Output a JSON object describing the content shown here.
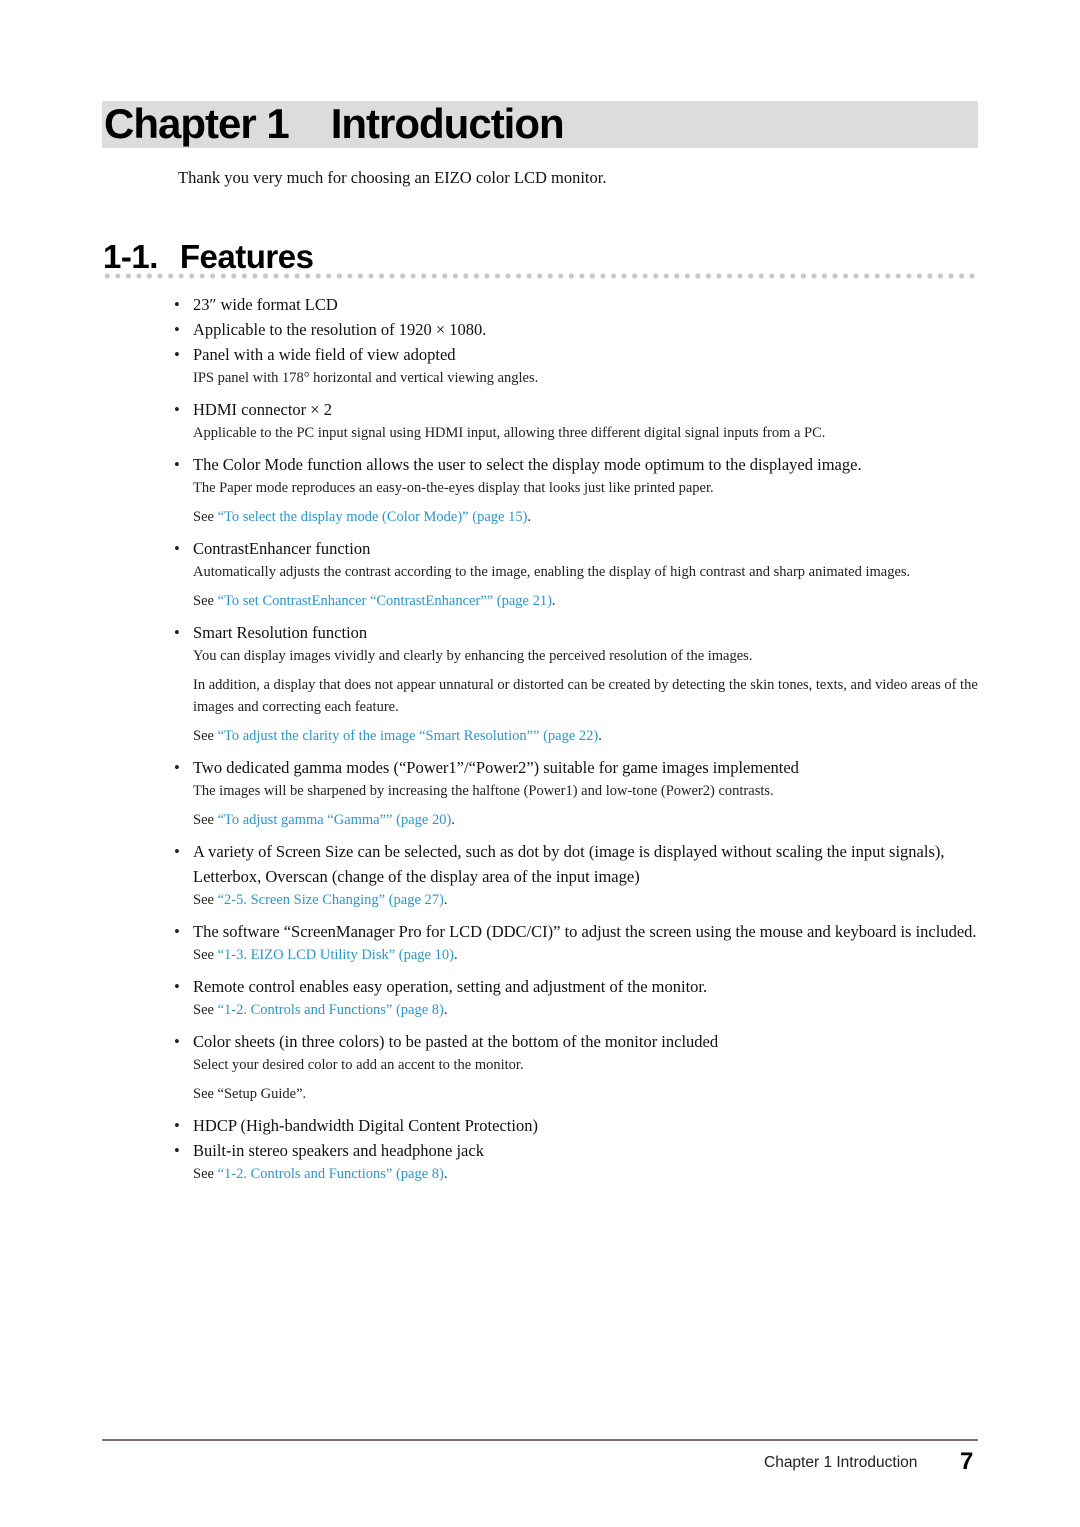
{
  "chapter": {
    "number_label": "Chapter 1",
    "title": "Introduction"
  },
  "intro": "Thank you very much for choosing an EIZO color LCD monitor.",
  "section": {
    "number": "1-1.",
    "title": "Features"
  },
  "features": [
    {
      "main": "23″ wide format LCD"
    },
    {
      "main": "Applicable to the resolution of 1920 × 1080."
    },
    {
      "main": "Panel with a wide field of view adopted",
      "sub": [
        "IPS panel with 178° horizontal and vertical viewing angles."
      ]
    },
    {
      "main": "HDMI connector × 2",
      "sub": [
        "Applicable to the PC input signal using HDMI input, allowing three different digital signal inputs from a PC."
      ]
    },
    {
      "main": "The Color Mode function allows the user to select the display mode optimum to the displayed image.",
      "sub": [
        "The Paper mode reproduces an easy-on-the-eyes display that looks just like printed paper."
      ],
      "see": {
        "prefix": "See ",
        "link": "“To select the display mode (Color Mode)” (page 15)",
        "suffix": "."
      }
    },
    {
      "main": "ContrastEnhancer function",
      "sub": [
        "Automatically adjusts the contrast according to the image, enabling the display of high contrast and sharp animated images."
      ],
      "see": {
        "prefix": "See ",
        "link": "“To set ContrastEnhancer “ContrastEnhancer”” (page 21)",
        "suffix": "."
      }
    },
    {
      "main": "Smart Resolution function",
      "sub": [
        "You can display images vividly and clearly by enhancing the perceived resolution of the images.",
        "In addition, a display that does not appear unnatural or distorted can be created by detecting the skin tones, texts, and video areas of the images and correcting each feature."
      ],
      "see": {
        "prefix": "See ",
        "link": "“To adjust the clarity of the image “Smart Resolution”” (page 22)",
        "suffix": "."
      }
    },
    {
      "main": "Two dedicated gamma modes (“Power1”/“Power2”) suitable for game images implemented",
      "sub": [
        "The images will be sharpened by increasing the halftone (Power1) and low-tone (Power2) contrasts."
      ],
      "see": {
        "prefix": "See ",
        "link": "“To adjust gamma “Gamma”” (page 20)",
        "suffix": "."
      }
    },
    {
      "main": "A variety of Screen Size can be selected, such as dot by dot (image is displayed without scaling the input signals), Letterbox, Overscan (change of the display area of the input image)",
      "see": {
        "prefix": "See ",
        "link": "“2-5. Screen Size Changing” (page 27)",
        "suffix": "."
      }
    },
    {
      "main": "The software “ScreenManager Pro for LCD (DDC/CI)” to adjust the screen using the mouse and keyboard is included.",
      "see": {
        "prefix": "See ",
        "link": "“1-3. EIZO LCD Utility Disk” (page 10)",
        "suffix": "."
      }
    },
    {
      "main": "Remote control enables easy operation, setting and adjustment of the monitor.",
      "see": {
        "prefix": "See ",
        "link": "“1-2. Controls and Functions” (page 8)",
        "suffix": "."
      }
    },
    {
      "main": "Color sheets (in three colors) to be pasted at the bottom of the monitor included",
      "sub": [
        "Select your desired color to add an accent to the monitor."
      ],
      "see_plain": "See “Setup Guide”."
    },
    {
      "main": "HDCP (High-bandwidth Digital Content Protection)"
    },
    {
      "main": "Built-in stereo speakers and headphone jack",
      "see": {
        "prefix": "See ",
        "link": "“1-2. Controls and Functions” (page 8)",
        "suffix": "."
      }
    }
  ],
  "footer": {
    "label": "Chapter 1 Introduction",
    "page": "7"
  },
  "colors": {
    "link": "#2a96c8",
    "chapter_bar": "#dcdcdc"
  }
}
